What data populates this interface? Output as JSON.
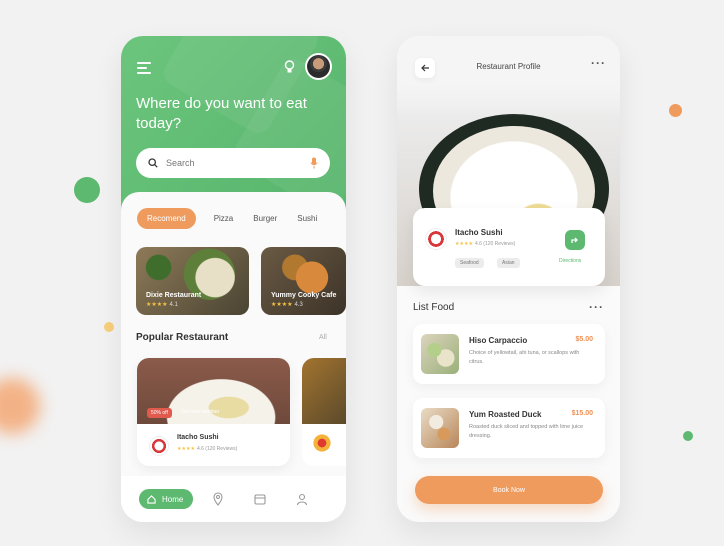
{
  "colors": {
    "green": "#5cb96f",
    "orange": "#ef9b5e",
    "star": "#f5c242"
  },
  "home": {
    "headline": "Where do you want to eat today?",
    "search_placeholder": "Search",
    "categories": [
      "Recomend",
      "Pizza",
      "Burger",
      "Sushi"
    ],
    "featured": [
      {
        "name": "Dixie Restaurant",
        "rating": "★★★★",
        "rating_rest": "4.1"
      },
      {
        "name": "Yummy Cooky Cafe",
        "rating": "★★★★",
        "rating_rest": "4.3"
      }
    ],
    "popular_title": "Popular Restaurant",
    "popular_link": "All",
    "popular_card": {
      "badge": "50% off",
      "promo": "Get new member",
      "name": "Itacho Sushi",
      "rating": "★★★★",
      "rating_rest": "4.6 (120 Reviews)"
    },
    "nav_home": "Home"
  },
  "profile": {
    "title": "Restaurant Profile",
    "restaurant_name": "Itacho Sushi",
    "rating": "★★★★",
    "rating_rest": "4.6 (120 Reviews)",
    "tags": [
      "Seafood",
      "Asian"
    ],
    "direction_label": "Directions",
    "list_title": "List Food",
    "foods": [
      {
        "name": "Hiso Carpaccio",
        "price": "$5.00",
        "desc": "Choice of yellowtail, ahi tuna, or scallops with citrus."
      },
      {
        "name": "Yum Roasted Duck",
        "price": "$15.00",
        "desc": "Roasted duck sliced and topped with lime juice dressing."
      }
    ],
    "book_label": "Book Now"
  }
}
